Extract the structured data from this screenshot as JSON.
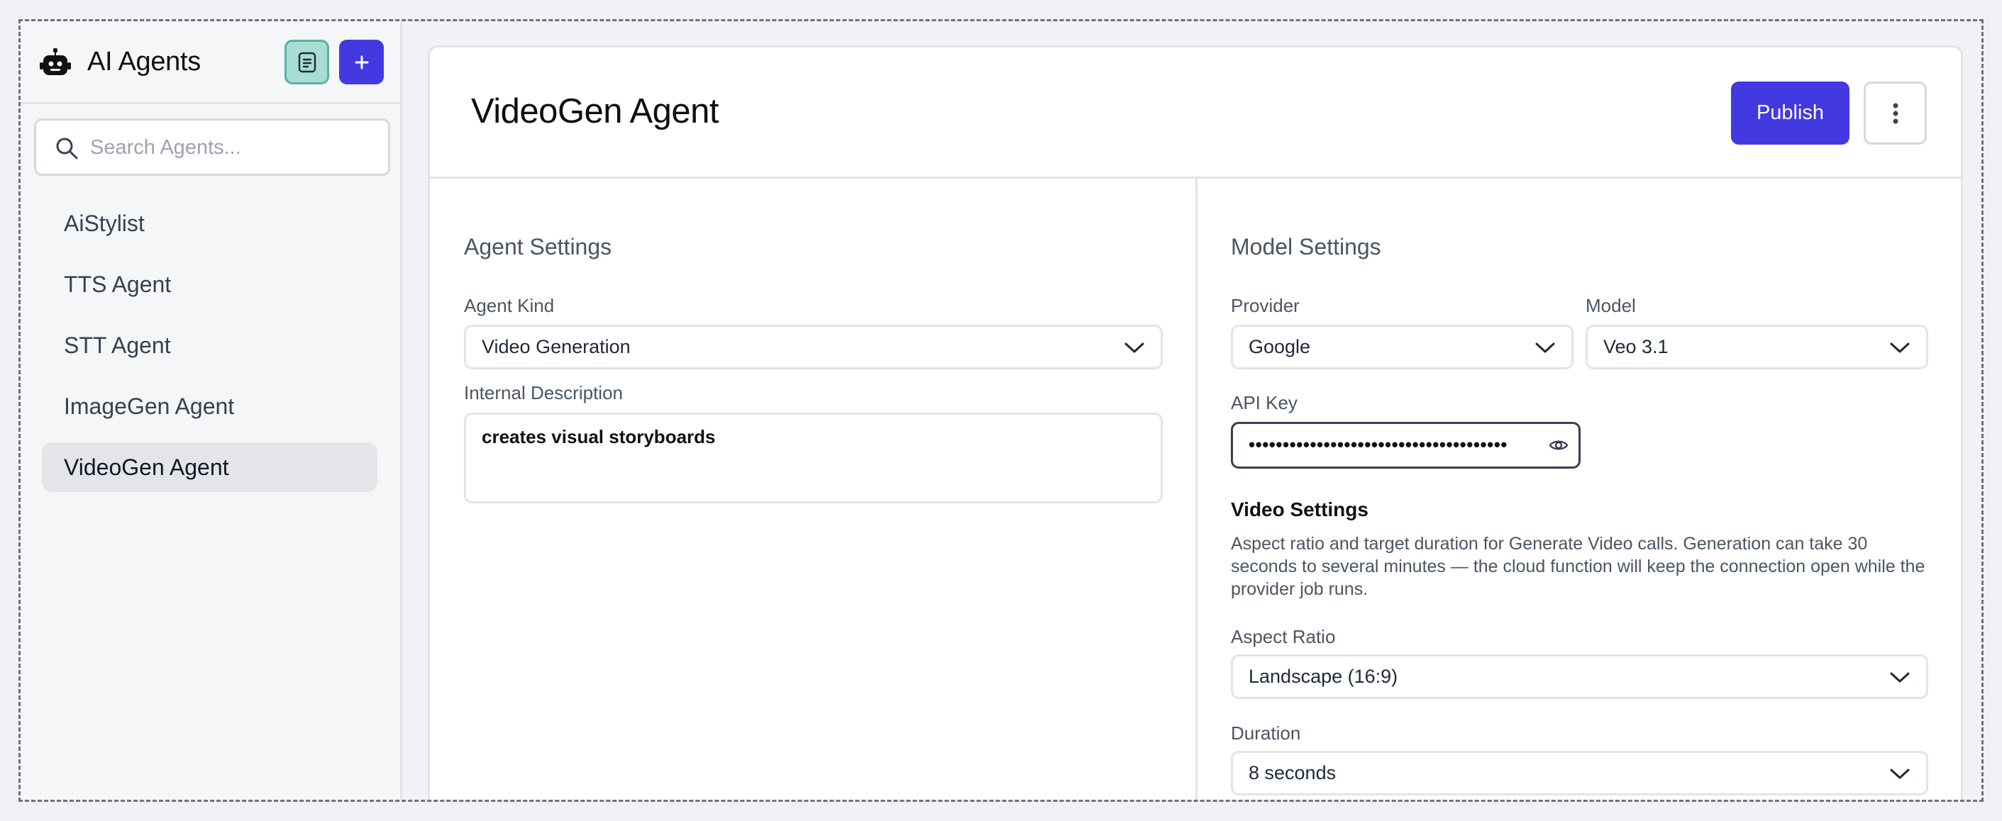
{
  "sidebar": {
    "title": "AI Agents",
    "search_placeholder": "Search Agents...",
    "items": [
      {
        "label": "AiStylist"
      },
      {
        "label": "TTS Agent"
      },
      {
        "label": "STT Agent"
      },
      {
        "label": "ImageGen Agent"
      },
      {
        "label": "VideoGen Agent",
        "active": true
      }
    ]
  },
  "header": {
    "title": "VideoGen Agent",
    "publish_label": "Publish"
  },
  "agent_settings": {
    "section_title": "Agent Settings",
    "agent_kind_label": "Agent Kind",
    "agent_kind_value": "Video Generation",
    "description_label": "Internal Description",
    "description_value": "creates visual storyboards"
  },
  "model_settings": {
    "section_title": "Model Settings",
    "provider_label": "Provider",
    "provider_value": "Google",
    "model_label": "Model",
    "model_value": "Veo 3.1",
    "api_key_label": "API Key",
    "api_key_value": "••••••••••••••••••••••••••••••••••••••"
  },
  "video_settings": {
    "title": "Video Settings",
    "help": "Aspect ratio and target duration for Generate Video calls. Generation can take 30 seconds to several minutes — the cloud function will keep the connection open while the provider job runs.",
    "aspect_label": "Aspect Ratio",
    "aspect_value": "Landscape (16:9)",
    "duration_label": "Duration",
    "duration_value": "8 seconds"
  },
  "colors": {
    "accent": "#4339e0",
    "notes_button_bg": "#a7ddd3",
    "active_item_bg": "#e3e5e9"
  },
  "icons": [
    "robot-icon",
    "notes-icon",
    "plus-icon",
    "search-icon",
    "kebab-icon",
    "chevron-down-icon",
    "eye-icon"
  ]
}
